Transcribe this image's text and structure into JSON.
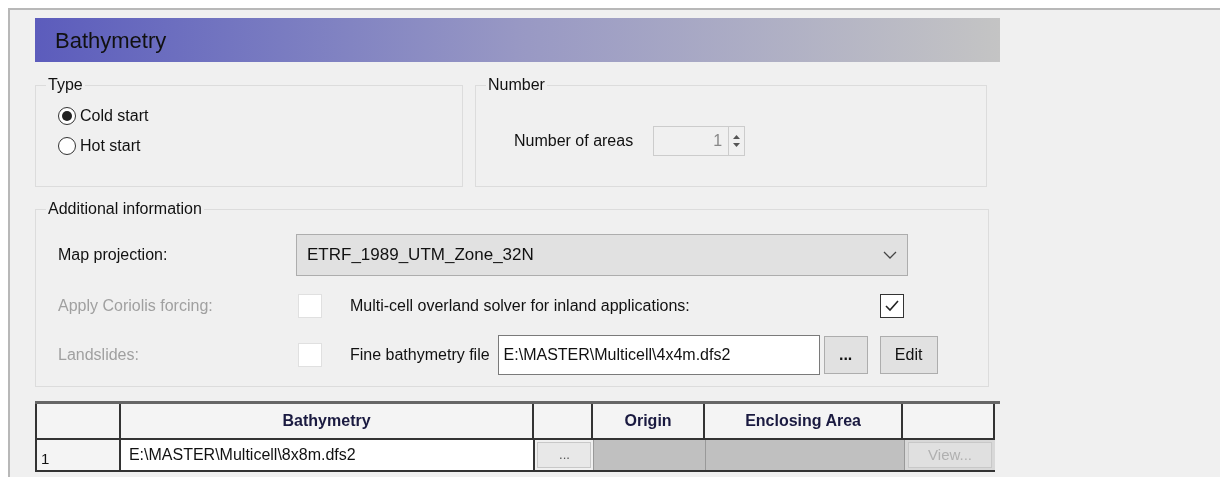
{
  "header": {
    "title": "Bathymetry"
  },
  "type_group": {
    "title": "Type",
    "options": [
      {
        "label": "Cold start",
        "selected": true
      },
      {
        "label": "Hot start",
        "selected": false
      }
    ]
  },
  "number_group": {
    "title": "Number",
    "label": "Number of areas",
    "value": "1"
  },
  "additional": {
    "title": "Additional information",
    "map_projection": {
      "label": "Map projection:",
      "value": "ETRF_1989_UTM_Zone_32N"
    },
    "coriolis": {
      "label": "Apply Coriolis forcing:",
      "checked": false,
      "disabled": true
    },
    "landslides": {
      "label": "Landslides:",
      "checked": false,
      "disabled": true
    },
    "multicell": {
      "label": "Multi-cell overland solver for inland applications:",
      "checked": true,
      "disabled": false
    },
    "fine_file": {
      "label": "Fine bathymetry file",
      "value": "E:\\MASTER\\Multicell\\4x4m.dfs2",
      "browse": "...",
      "edit": "Edit"
    }
  },
  "table": {
    "columns": [
      {
        "kind": "index"
      },
      {
        "kind": "text",
        "label": "Bathymetry"
      },
      {
        "kind": "browse"
      },
      {
        "kind": "text",
        "label": "Origin"
      },
      {
        "kind": "text",
        "label": "Enclosing Area"
      },
      {
        "kind": "view"
      }
    ],
    "rows": [
      {
        "index": "1",
        "bathymetry": "E:\\MASTER\\Multicell\\8x8m.dfs2",
        "browse": "...",
        "view": "View...",
        "view_disabled": true
      }
    ]
  }
}
